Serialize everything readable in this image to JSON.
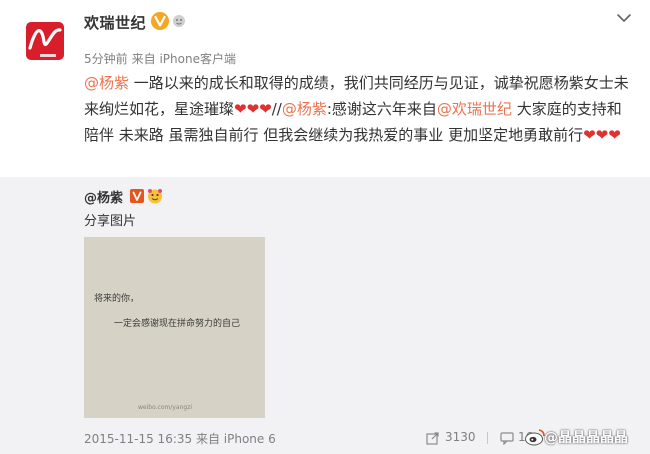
{
  "post": {
    "author": "欢瑞世纪",
    "meta": {
      "time": "5分钟前",
      "source": "来自 iPhone客户端"
    },
    "body": {
      "mention1": "@杨紫",
      "text1": " 一路以来的成长和取得的成绩，我们共同经历与见证，诚挚祝愿杨紫女士未来绚烂如花，星途璀璨",
      "hearts1": "❤❤❤",
      "sep": "//",
      "mention2": "@杨紫",
      "text2": ":感谢这六年来自",
      "mention3": "@欢瑞世纪",
      "text3": " 大家庭的支持和陪伴 未来路 虽需独自前行 但我会继续为我热爱的事业 更加坚定地勇敢前行",
      "hearts2": "❤❤❤"
    }
  },
  "repost": {
    "author": "@杨紫",
    "text": "分享图片",
    "image": {
      "line1": "将来的你，",
      "line2": "一定会感谢现在拼命努力的自己",
      "mark": "weibo.com/yangzi"
    },
    "footer": {
      "date": "2015-11-15 16:35",
      "source": "来自 iPhone 6",
      "share_count": "3130",
      "comment_count": "16",
      "watermark": "@晶晶晶晶晶"
    }
  },
  "colors": {
    "link": "#eb7350",
    "heart": "#e03030",
    "verified": "#f6a623",
    "repost_bg": "#f2f2f5",
    "brand_red": "#d81e2b"
  },
  "icons": [
    "huanrui-logo",
    "verified-icon",
    "member-icon",
    "more-chevron-icon",
    "v-badge-icon",
    "face-icon",
    "share-icon",
    "comment-icon",
    "weibo-logo-icon"
  ]
}
